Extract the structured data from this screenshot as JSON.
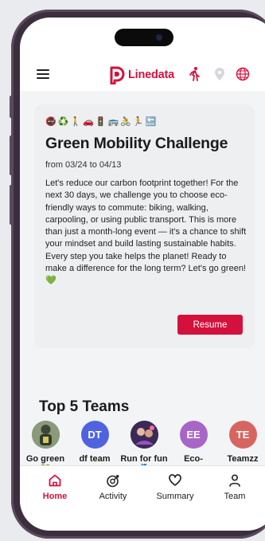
{
  "header": {
    "brand_name": "Linedata",
    "menu_icon": "hamburger-menu-icon",
    "brand_color": "#d4113d"
  },
  "challenge": {
    "emojis": [
      "🚭",
      "♻️",
      "🚶",
      "🚗",
      "🚦",
      "🚌",
      "🚴",
      "🏃",
      "🔙"
    ],
    "title": "Green Mobility Challenge",
    "dates": "from 03/24 to 04/13",
    "description": "Let's reduce our carbon footprint together! For the next 30 days, we challenge you to choose eco-friendly ways to commute: biking, walking, carpooling, or using public transport. This is more than just a month-long event — it's a chance to shift your mindset and build lasting sustainable habits. Every step you take helps the planet! Ready to make a difference for the long term? Let's go green! 💚",
    "resume_label": "Resume"
  },
  "teams": {
    "title": "Top 5 Teams",
    "items": [
      {
        "name": "Go green 💚",
        "initials": "",
        "color": "#6b7a5e"
      },
      {
        "name": "df team",
        "initials": "DT",
        "color": "#4f63e0"
      },
      {
        "name": "Run for fun 🏅",
        "initials": "",
        "color": "#5a3f7a"
      },
      {
        "name": "Eco-friendl...",
        "initials": "EE",
        "color": "#a865c8"
      },
      {
        "name": "Teamzz",
        "initials": "TE",
        "color": "#d6655f"
      }
    ]
  },
  "nav": {
    "items": [
      {
        "label": "Home",
        "icon": "home-icon"
      },
      {
        "label": "Activity",
        "icon": "activity-icon"
      },
      {
        "label": "Summary",
        "icon": "heart-icon"
      },
      {
        "label": "Team",
        "icon": "team-icon"
      }
    ],
    "active": "Home"
  }
}
